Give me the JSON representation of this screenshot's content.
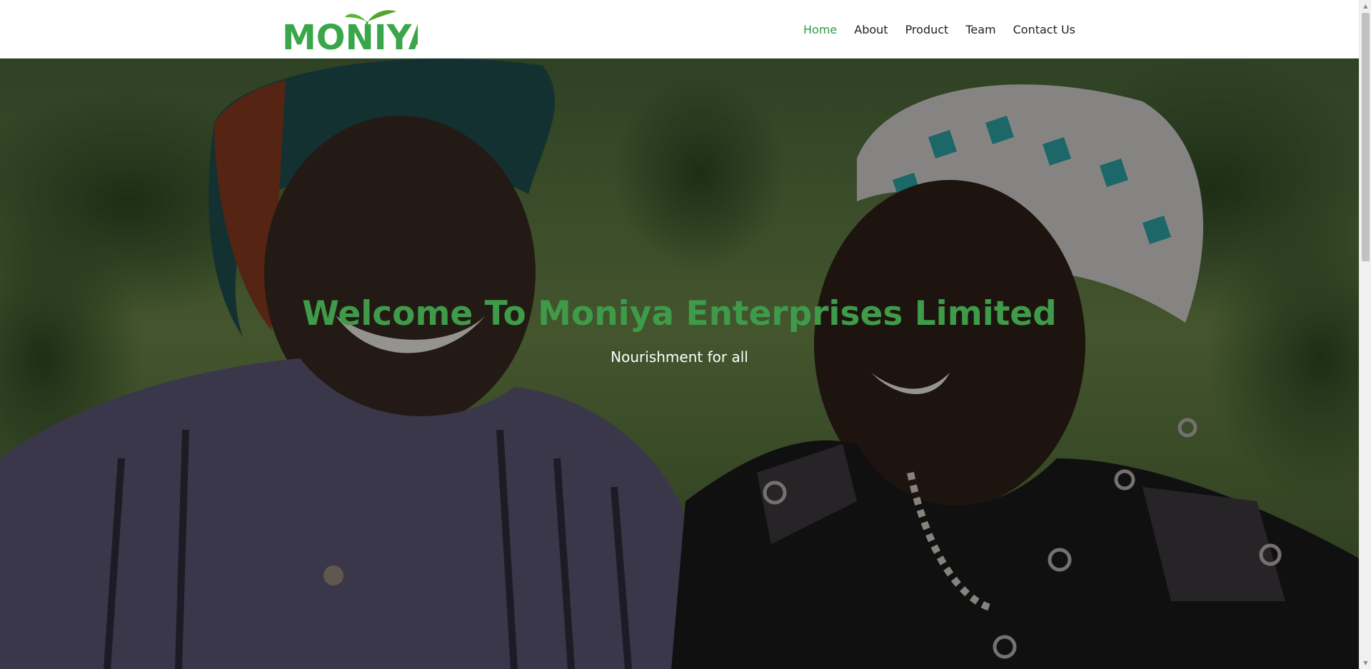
{
  "brand": {
    "logo_text": "MONIYA",
    "logo_color": "#3aa64a",
    "leaf_color": "#5cb531"
  },
  "nav": {
    "items": [
      {
        "label": "Home",
        "active": true
      },
      {
        "label": "About",
        "active": false
      },
      {
        "label": "Product",
        "active": false
      },
      {
        "label": "Team",
        "active": false
      },
      {
        "label": "Contact Us",
        "active": false
      }
    ],
    "active_color": "#2f9a45"
  },
  "hero": {
    "title": "Welcome To Moniya Enterprises Limited",
    "subtitle": "Nourishment for all",
    "title_color": "#3f9a4a",
    "image_description_icon": "photo-two-smiling-women-icon"
  }
}
